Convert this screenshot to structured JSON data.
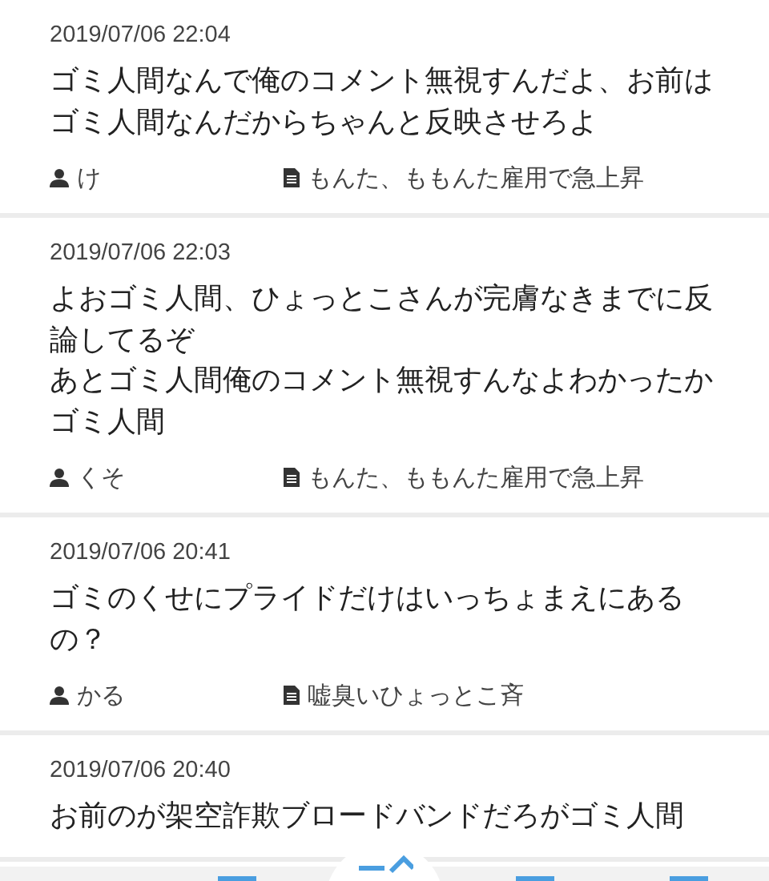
{
  "comments": [
    {
      "date": "2019/07/06 22:04",
      "body": "ゴミ人間なんで俺のコメント無視すんだよ、お前はゴミ人間なんだからちゃんと反映させろよ",
      "user": "け",
      "article": "もんた、ももんた雇用で急上昇"
    },
    {
      "date": "2019/07/06 22:03",
      "body": [
        "よおゴミ人間、ひょっとこさんが完膚なきまでに反論してるぞ",
        "あとゴミ人間俺のコメント無視すんなよわかったかゴミ人間"
      ],
      "user": "くそ",
      "article": "もんた、ももんた雇用で急上昇"
    },
    {
      "date": "2019/07/06 20:41",
      "body": "ゴミのくせにプライドだけはいっちょまえにあるの？",
      "user": "かる",
      "article": "嘘臭いひょっとこ斉"
    },
    {
      "date": "2019/07/06 20:40",
      "body": "お前のが架空詐欺ブロードバンドだろがゴミ人間"
    }
  ]
}
